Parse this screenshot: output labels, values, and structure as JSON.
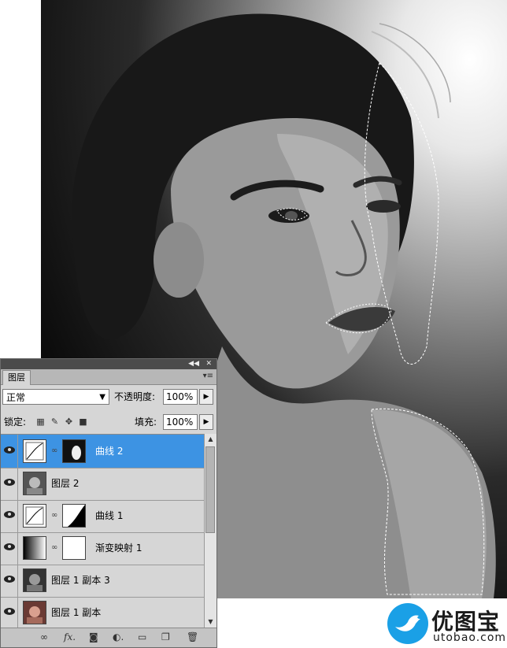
{
  "panel": {
    "tab_label": "图层",
    "blend_mode": "正常",
    "opacity_label": "不透明度:",
    "opacity_value": "100%",
    "lock_label": "锁定:",
    "fill_label": "填充:",
    "fill_value": "100%"
  },
  "layers": [
    {
      "name": "曲线 2",
      "selected": true,
      "type": "adjustment-with-mask"
    },
    {
      "name": "图层 2",
      "selected": false,
      "type": "photo"
    },
    {
      "name": "曲线 1",
      "selected": false,
      "type": "adjustment-with-mask"
    },
    {
      "name": "渐变映射 1",
      "selected": false,
      "type": "adjustment-with-mask"
    },
    {
      "name": "图层 1 副本 3",
      "selected": false,
      "type": "photo"
    },
    {
      "name": "图层 1 副本",
      "selected": false,
      "type": "photo"
    }
  ],
  "bottom_icons": [
    "link-icon",
    "fx-icon",
    "mask-icon",
    "adjustment-icon",
    "folder-icon",
    "new-layer-icon",
    "trash-icon"
  ],
  "watermark": {
    "title": "优图宝",
    "url": "utobao.com",
    "color": "#1aa0e6"
  },
  "colors": {
    "selection": "#3d93e3",
    "panel_bg": "#d6d6d6"
  }
}
